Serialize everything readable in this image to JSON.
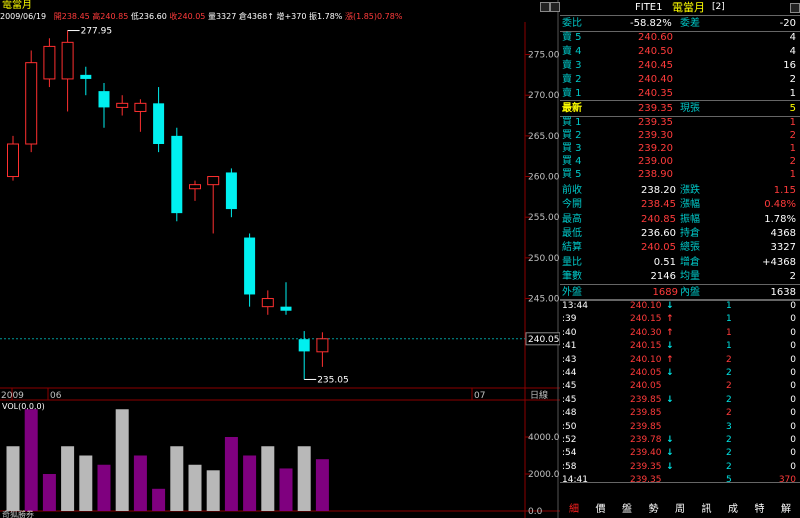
{
  "chart_title": "電當月",
  "ohlc_info": {
    "date": "2009/06/19",
    "open_label": "開",
    "open": "238.45",
    "high_label": "高",
    "high": "240.85",
    "low_label": "低",
    "low": "236.60",
    "close_label": "收",
    "close": "240.05",
    "vol_label": "量",
    "vol": "3327",
    "oi_label": "倉",
    "oi": "4368",
    "oi_arrow": "↑",
    "inc_label": "增",
    "inc": "+370",
    "amp_label": "振",
    "amp": "1.78%",
    "chg_label": "漲",
    "chg": "(1.85)",
    "chg_pct": "0.78%"
  },
  "price_axis_labels": [
    "275.00",
    "270.00",
    "265.00",
    "260.00",
    "255.00",
    "250.00",
    "245.00"
  ],
  "current_price_tag": "240.05",
  "high_annotation": "277.95",
  "low_annotation": "235.05",
  "date_axis": {
    "year": "2009",
    "month_start": "06",
    "month_end": "07",
    "period": "日線"
  },
  "volume_label": "VOL(0,0,0)",
  "volume_axis_labels": [
    "4000.0",
    "2000.0",
    "0.0"
  ],
  "chart_footer": "奇狐勝券",
  "chart_data": {
    "type": "candlestick",
    "ylim": [
      234,
      279
    ],
    "candles": [
      {
        "o": 260.0,
        "h": 265.0,
        "l": 259.5,
        "c": 264.0
      },
      {
        "o": 264.0,
        "h": 275.5,
        "l": 263.0,
        "c": 274.0
      },
      {
        "o": 272.0,
        "h": 277.0,
        "l": 271.0,
        "c": 276.0
      },
      {
        "o": 272.0,
        "h": 277.95,
        "l": 268.0,
        "c": 276.5
      },
      {
        "o": 272.5,
        "h": 273.5,
        "l": 270.0,
        "c": 272.0
      },
      {
        "o": 270.5,
        "h": 271.5,
        "l": 266.0,
        "c": 268.5
      },
      {
        "o": 268.5,
        "h": 270.0,
        "l": 267.5,
        "c": 269.0
      },
      {
        "o": 268.0,
        "h": 269.5,
        "l": 265.5,
        "c": 269.0
      },
      {
        "o": 269.0,
        "h": 271.0,
        "l": 263.0,
        "c": 264.0
      },
      {
        "o": 265.0,
        "h": 266.0,
        "l": 254.5,
        "c": 255.5
      },
      {
        "o": 258.5,
        "h": 259.5,
        "l": 257.0,
        "c": 259.0
      },
      {
        "o": 259.0,
        "h": 260.0,
        "l": 253.0,
        "c": 260.0
      },
      {
        "o": 260.5,
        "h": 261.0,
        "l": 255.0,
        "c": 256.0
      },
      {
        "o": 252.5,
        "h": 253.0,
        "l": 244.0,
        "c": 245.5
      },
      {
        "o": 244.0,
        "h": 246.0,
        "l": 243.0,
        "c": 245.0
      },
      {
        "o": 244.0,
        "h": 247.0,
        "l": 243.0,
        "c": 243.5
      },
      {
        "o": 240.0,
        "h": 241.0,
        "l": 235.05,
        "c": 238.5
      },
      {
        "o": 238.45,
        "h": 240.85,
        "l": 236.6,
        "c": 240.05
      }
    ],
    "volume": {
      "ylim": [
        0,
        6000
      ],
      "values": [
        3500,
        5500,
        2000,
        3500,
        3000,
        2500,
        5500,
        3000,
        1200,
        3500,
        2500,
        2200,
        4000,
        3000,
        3500,
        2300,
        3500,
        2800
      ],
      "colors": [
        "gray",
        "purple",
        "purple",
        "gray",
        "gray",
        "purple",
        "gray",
        "purple",
        "purple",
        "gray",
        "gray",
        "gray",
        "purple",
        "purple",
        "gray",
        "purple",
        "gray",
        "purple"
      ]
    }
  },
  "colors": {
    "up": "#ff3030",
    "down": "#00f0f0",
    "vol_gray": "#b8b8b8",
    "vol_purple": "#7f007f",
    "axis": "#8b0000",
    "grid": "#555555"
  },
  "quote": {
    "header": {
      "symbol": "FITE1",
      "name": "電當月",
      "seq": "[2]"
    },
    "ratio": {
      "label": "委比",
      "value": "-58.82%",
      "diff_label": "委差",
      "diff": "-20"
    },
    "asks": [
      {
        "label": "賣 5",
        "price": "240.60",
        "vol": "4"
      },
      {
        "label": "賣 4",
        "price": "240.50",
        "vol": "4"
      },
      {
        "label": "賣 3",
        "price": "240.45",
        "vol": "16"
      },
      {
        "label": "賣 2",
        "price": "240.40",
        "vol": "2"
      },
      {
        "label": "賣 1",
        "price": "240.35",
        "vol": "1"
      }
    ],
    "last": {
      "label": "最新",
      "price": "239.35",
      "cur_label": "現張",
      "cur": "5"
    },
    "bids": [
      {
        "label": "買 1",
        "price": "239.35",
        "vol": "1"
      },
      {
        "label": "買 2",
        "price": "239.30",
        "vol": "2"
      },
      {
        "label": "買 3",
        "price": "239.20",
        "vol": "1"
      },
      {
        "label": "買 4",
        "price": "239.00",
        "vol": "2"
      },
      {
        "label": "買 5",
        "price": "238.90",
        "vol": "1"
      }
    ],
    "stats": [
      {
        "l1": "前收",
        "v1": "238.20",
        "c1": "white",
        "l2": "漲跌",
        "v2": "1.15",
        "c2": "red"
      },
      {
        "l1": "今開",
        "v1": "238.45",
        "c1": "red",
        "l2": "漲幅",
        "v2": "0.48%",
        "c2": "red"
      },
      {
        "l1": "最高",
        "v1": "240.85",
        "c1": "red",
        "l2": "振幅",
        "v2": "1.78%",
        "c2": "white"
      },
      {
        "l1": "最低",
        "v1": "236.60",
        "c1": "white",
        "l2": "持倉",
        "v2": "4368",
        "c2": "white"
      },
      {
        "l1": "結算",
        "v1": "240.05",
        "c1": "red",
        "l2": "總張",
        "v2": "3327",
        "c2": "white"
      },
      {
        "l1": "量比",
        "v1": "0.51",
        "c1": "white",
        "l2": "增倉",
        "v2": "+4368",
        "c2": "white"
      },
      {
        "l1": "筆數",
        "v1": "2146",
        "c1": "white",
        "l2": "均量",
        "v2": "2",
        "c2": "white"
      }
    ],
    "outer_inner": {
      "outer_label": "外盤",
      "outer": "1689",
      "inner_label": "內盤",
      "inner": "1638"
    }
  },
  "ticks": [
    {
      "time": "13:44",
      "price": "240.10",
      "arrow": "↓",
      "dir": "down",
      "vol": "1",
      "vc": "green",
      "oi": "0"
    },
    {
      "time": ":39",
      "price": "240.15",
      "arrow": "↑",
      "dir": "up",
      "vol": "1",
      "vc": "green",
      "oi": "0"
    },
    {
      "time": ":40",
      "price": "240.30",
      "arrow": "↑",
      "dir": "up",
      "vol": "1",
      "vc": "red",
      "oi": "0"
    },
    {
      "time": ":41",
      "price": "240.15",
      "arrow": "↓",
      "dir": "down",
      "vol": "1",
      "vc": "green",
      "oi": "0"
    },
    {
      "time": ":43",
      "price": "240.10",
      "arrow": "↑",
      "dir": "up",
      "vol": "2",
      "vc": "red",
      "oi": "0"
    },
    {
      "time": ":44",
      "price": "240.05",
      "arrow": "↓",
      "dir": "down",
      "vol": "2",
      "vc": "green",
      "oi": "0"
    },
    {
      "time": ":45",
      "price": "240.05",
      "arrow": "",
      "dir": "none",
      "vol": "2",
      "vc": "red",
      "oi": "0"
    },
    {
      "time": ":45",
      "price": "239.85",
      "arrow": "↓",
      "dir": "down",
      "vol": "2",
      "vc": "green",
      "oi": "0"
    },
    {
      "time": ":48",
      "price": "239.85",
      "arrow": "",
      "dir": "none",
      "vol": "2",
      "vc": "red",
      "oi": "0"
    },
    {
      "time": ":50",
      "price": "239.85",
      "arrow": "",
      "dir": "none",
      "vol": "3",
      "vc": "green",
      "oi": "0"
    },
    {
      "time": ":52",
      "price": "239.78",
      "arrow": "↓",
      "dir": "down",
      "vol": "2",
      "vc": "green",
      "oi": "0"
    },
    {
      "time": ":54",
      "price": "239.40",
      "arrow": "↓",
      "dir": "down",
      "vol": "2",
      "vc": "green",
      "oi": "0"
    },
    {
      "time": ":58",
      "price": "239.35",
      "arrow": "↓",
      "dir": "down",
      "vol": "2",
      "vc": "green",
      "oi": "0"
    },
    {
      "time": "14:41",
      "price": "239.35",
      "arrow": "",
      "dir": "none",
      "vol": "5",
      "vc": "green",
      "oi": "370"
    }
  ],
  "tabs": [
    "細",
    "價",
    "盤",
    "勢",
    "周",
    "訊",
    "成",
    "特",
    "解"
  ]
}
